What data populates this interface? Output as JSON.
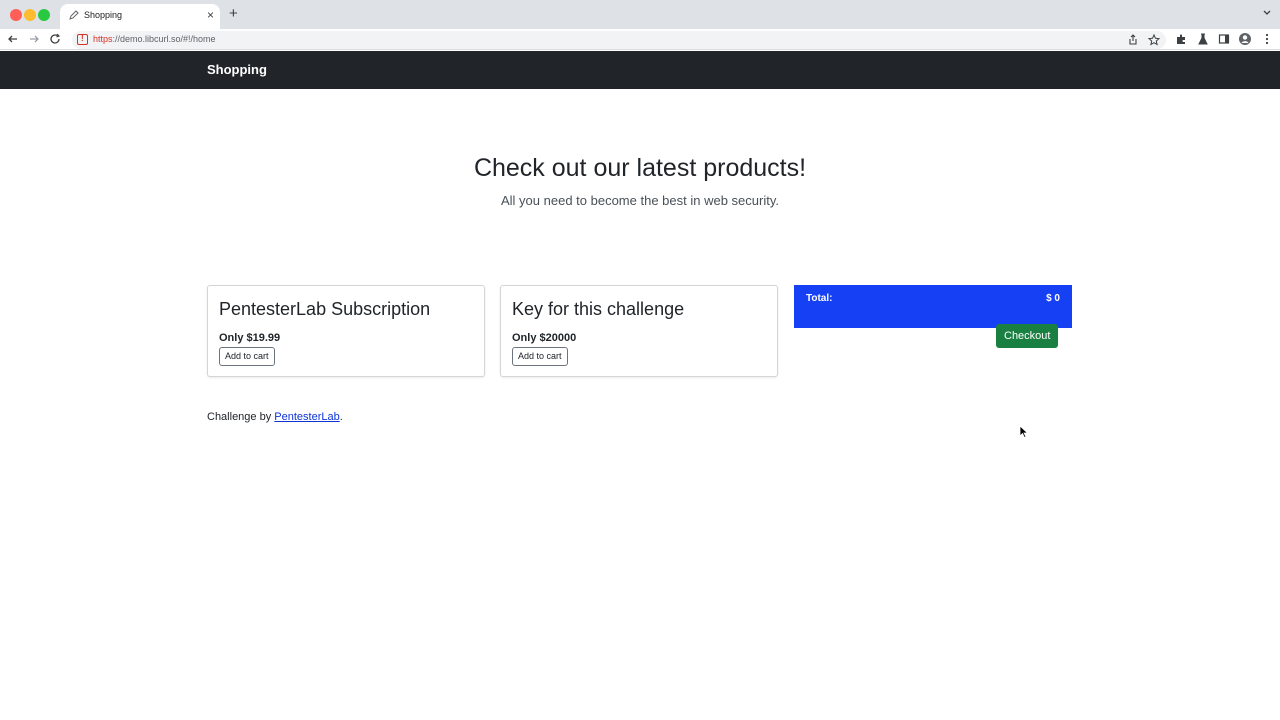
{
  "browser": {
    "tab_title": "Shopping",
    "url_scheme": "https",
    "url_rest": "://demo.libcurl.so/#!/home",
    "colors": {
      "tabstrip": "#dee1e6",
      "insecure": "#d93025"
    }
  },
  "navbar": {
    "brand": "Shopping"
  },
  "hero": {
    "title": "Check out our latest products!",
    "subtitle": "All you need to become the best in web security."
  },
  "products": [
    {
      "title": "PentesterLab Subscription",
      "price": "Only $19.99",
      "button": "Add to cart"
    },
    {
      "title": "Key for this challenge",
      "price": "Only $20000",
      "button": "Add to cart"
    }
  ],
  "cart": {
    "label": "Total:",
    "total": "$ 0",
    "checkout": "Checkout",
    "colors": {
      "panel": "#1540f4",
      "checkout": "#198042"
    }
  },
  "footer": {
    "prefix": "Challenge by ",
    "link": "PentesterLab",
    "suffix": "."
  }
}
